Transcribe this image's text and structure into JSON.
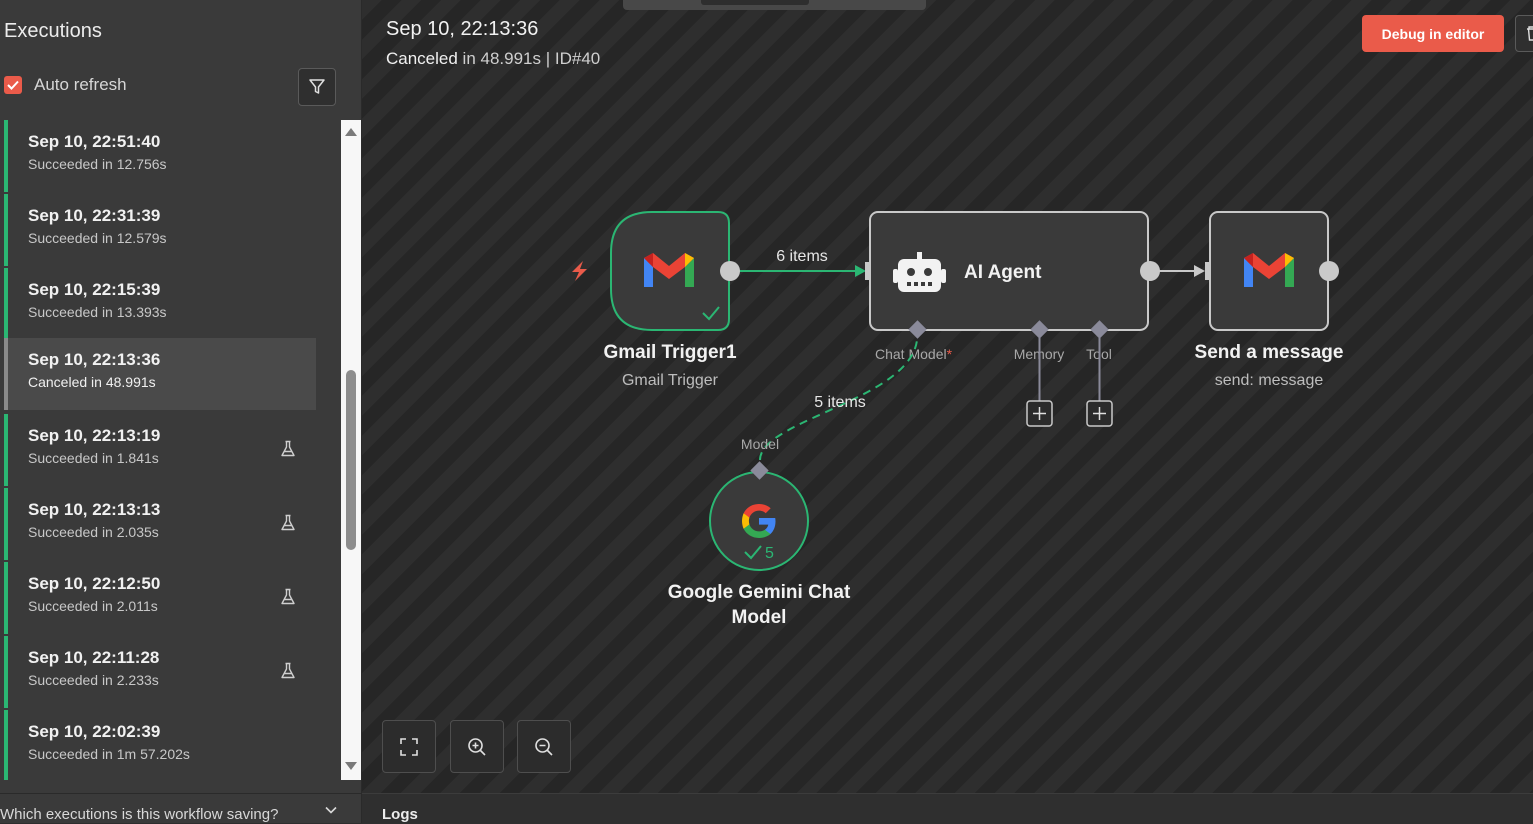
{
  "sidebar": {
    "title": "Executions",
    "auto_refresh_label": "Auto refresh",
    "auto_refresh_checked": true,
    "items": [
      {
        "date": "Sep 10, 22:51:40",
        "status": "Succeeded in 12.756s",
        "test": false
      },
      {
        "date": "Sep 10, 22:31:39",
        "status": "Succeeded in 12.579s",
        "test": false
      },
      {
        "date": "Sep 10, 22:15:39",
        "status": "Succeeded in 13.393s",
        "test": false
      },
      {
        "date": "Sep 10, 22:13:36",
        "status": "Canceled in 48.991s",
        "test": false,
        "selected": true
      },
      {
        "date": "Sep 10, 22:13:19",
        "status": "Succeeded in 1.841s",
        "test": true
      },
      {
        "date": "Sep 10, 22:13:13",
        "status": "Succeeded in 2.035s",
        "test": true
      },
      {
        "date": "Sep 10, 22:12:50",
        "status": "Succeeded in 2.011s",
        "test": true
      },
      {
        "date": "Sep 10, 22:11:28",
        "status": "Succeeded in 2.233s",
        "test": true
      },
      {
        "date": "Sep 10, 22:02:39",
        "status": "Succeeded in 1m 57.202s",
        "test": false
      }
    ],
    "saving_question": "Which executions is this workflow saving?"
  },
  "header": {
    "date": "Sep 10, 22:13:36",
    "status_word": "Canceled",
    "status_rest": " in 48.991s | ID#40",
    "debug_button": "Debug in editor"
  },
  "nodes": {
    "gmail_trigger": {
      "title": "Gmail Trigger1",
      "subtitle": "Gmail Trigger"
    },
    "ai_agent": {
      "title": "AI Agent"
    },
    "send_message": {
      "title": "Send a message",
      "subtitle": "send: message"
    },
    "gemini": {
      "title_line1": "Google Gemini Chat",
      "title_line2": "Model",
      "items_count": "5"
    }
  },
  "connections": {
    "trigger_to_agent": "6 items",
    "model_to_agent": "5 items"
  },
  "ports": {
    "chat_model": "Chat Model",
    "required_mark": "*",
    "memory": "Memory",
    "tool": "Tool",
    "model": "Model"
  },
  "footer": {
    "logs_label": "Logs"
  },
  "colors": {
    "accent": "#ea5b4a",
    "success": "#2bb673",
    "node_bg": "#3a3a3a",
    "node_border": "#c9c9c9"
  }
}
